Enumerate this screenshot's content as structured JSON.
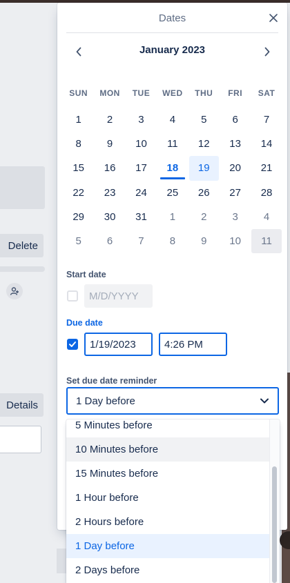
{
  "background": {
    "delete_label": "Delete",
    "details_label": "Details",
    "add_member_icon": "person-plus-icon"
  },
  "popover": {
    "title": "Dates",
    "close_icon": "close-icon"
  },
  "calendar": {
    "month_label": "January 2023",
    "weekdays": [
      "SUN",
      "MON",
      "TUE",
      "WED",
      "THU",
      "FRI",
      "SAT"
    ],
    "weeks": [
      [
        "1",
        "2",
        "3",
        "4",
        "5",
        "6",
        "7"
      ],
      [
        "8",
        "9",
        "10",
        "11",
        "12",
        "13",
        "14"
      ],
      [
        "15",
        "16",
        "17",
        "18",
        "19",
        "20",
        "21"
      ],
      [
        "22",
        "23",
        "24",
        "25",
        "26",
        "27",
        "28"
      ],
      [
        "29",
        "30",
        "31",
        "1",
        "2",
        "3",
        "4"
      ],
      [
        "5",
        "6",
        "7",
        "8",
        "9",
        "10",
        "11"
      ]
    ],
    "today": "18",
    "selected": "19"
  },
  "start_date": {
    "label": "Start date",
    "checked": false,
    "placeholder": "M/D/YYYY"
  },
  "due_date": {
    "label": "Due date",
    "checked": true,
    "date_value": "1/19/2023",
    "time_value": "4:26 PM"
  },
  "reminder": {
    "label": "Set due date reminder",
    "selected": "1 Day before",
    "options": [
      "5 Minutes before",
      "10 Minutes before",
      "15 Minutes before",
      "1 Hour before",
      "2 Hours before",
      "1 Day before",
      "2 Days before"
    ]
  },
  "colors": {
    "accent": "#0c66e4",
    "selected_bg": "#e9f2ff",
    "text": "#172b4d"
  }
}
